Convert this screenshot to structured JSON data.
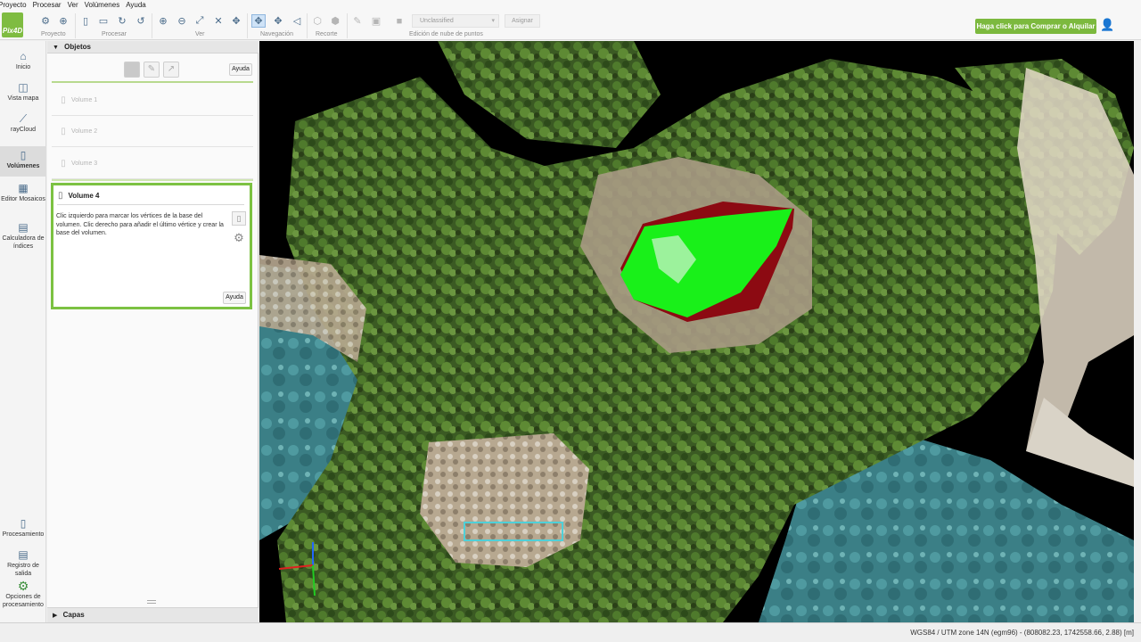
{
  "menubar": {
    "items": [
      "Proyecto",
      "Procesar",
      "Ver",
      "Volúmenes",
      "Ayuda"
    ]
  },
  "toolbar": {
    "logo_text": "Pix4D",
    "groups": [
      "Proyecto",
      "Procesar",
      "Ver",
      "Navegación",
      "Recorte",
      "Edición de nube de puntos"
    ],
    "class_select": "Unclassified",
    "assign_label": "Asignar",
    "buy_label": "Haga click para Comprar o Alquilar"
  },
  "leftnav": {
    "items": [
      {
        "label": "Inicio",
        "icon": "home-icon"
      },
      {
        "label": "Vista mapa",
        "icon": "map-icon"
      },
      {
        "label": "rayCloud",
        "icon": "raycloud-icon"
      },
      {
        "label": "Volúmenes",
        "icon": "volume-icon",
        "active": true
      },
      {
        "label": "Editor Mosaicos",
        "icon": "mosaic-editor-icon"
      },
      {
        "label": "Calculadora de índices",
        "icon": "index-calculator-icon"
      },
      {
        "label": "Procesamiento",
        "icon": "processing-icon"
      },
      {
        "label": "Registro de salida",
        "icon": "log-icon"
      },
      {
        "label": "Opciones de procesamiento",
        "icon": "gear-icon"
      }
    ]
  },
  "panel": {
    "title": "Objetos",
    "help_label": "Ayuda",
    "volumes": [
      "Volume 1",
      "Volume 2",
      "Volume 3"
    ],
    "active_volume": {
      "title": "Volume 4",
      "instructions": "Clic izquierdo para marcar los vértices de la base del volumen. Clic derecho para añadir el último vértice y crear la base del volumen.",
      "help_label": "Ayuda"
    },
    "layers_title": "Capas"
  },
  "statusbar": {
    "coords": "WGS84 / UTM zone 14N (egm96) - (808082.23, 1742558.66, 2.88) [m]"
  },
  "colors": {
    "accent_green": "#7cc242",
    "volume_top": "#19f019",
    "volume_side": "#8c0a12"
  }
}
